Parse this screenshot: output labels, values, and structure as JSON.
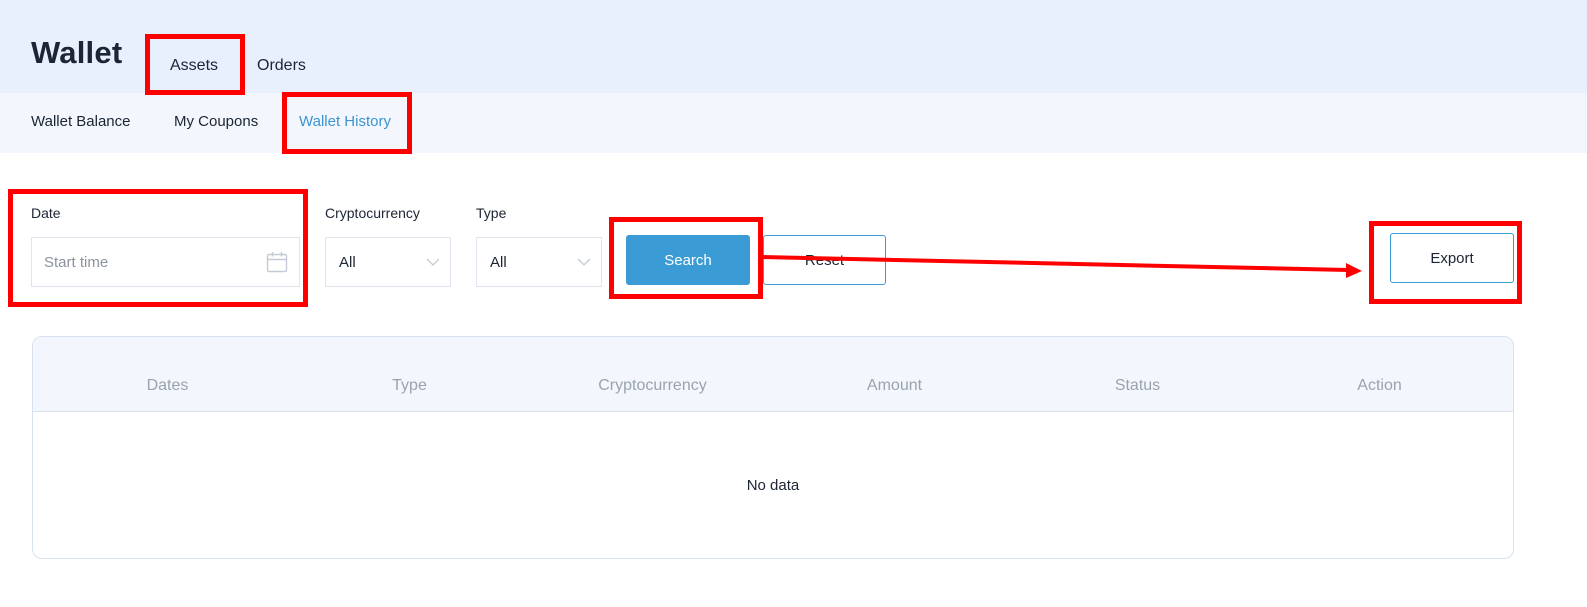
{
  "header": {
    "title": "Wallet",
    "tabs": [
      {
        "label": "Assets",
        "active": true
      },
      {
        "label": "Orders",
        "active": false
      }
    ]
  },
  "subnav": {
    "items": [
      {
        "label": "Wallet Balance"
      },
      {
        "label": "My Coupons"
      },
      {
        "label": "Wallet History",
        "active": true
      }
    ]
  },
  "filters": {
    "date": {
      "label": "Date",
      "placeholder": "Start time",
      "icon": "calendar-icon"
    },
    "cryptocurrency": {
      "label": "Cryptocurrency",
      "value": "All",
      "icon": "chevron-down-icon"
    },
    "type": {
      "label": "Type",
      "value": "All",
      "icon": "chevron-down-icon"
    }
  },
  "buttons": {
    "search": "Search",
    "reset": "Reset",
    "export": "Export"
  },
  "table": {
    "columns": [
      "Dates",
      "Type",
      "Cryptocurrency",
      "Amount",
      "Status",
      "Action"
    ],
    "rows": [],
    "empty_text": "No data"
  },
  "colors": {
    "accent": "#3a9bd5",
    "header_bg": "#e8f0fe",
    "subnav_bg": "#f3f7fd",
    "annotation": "#ff0000"
  }
}
